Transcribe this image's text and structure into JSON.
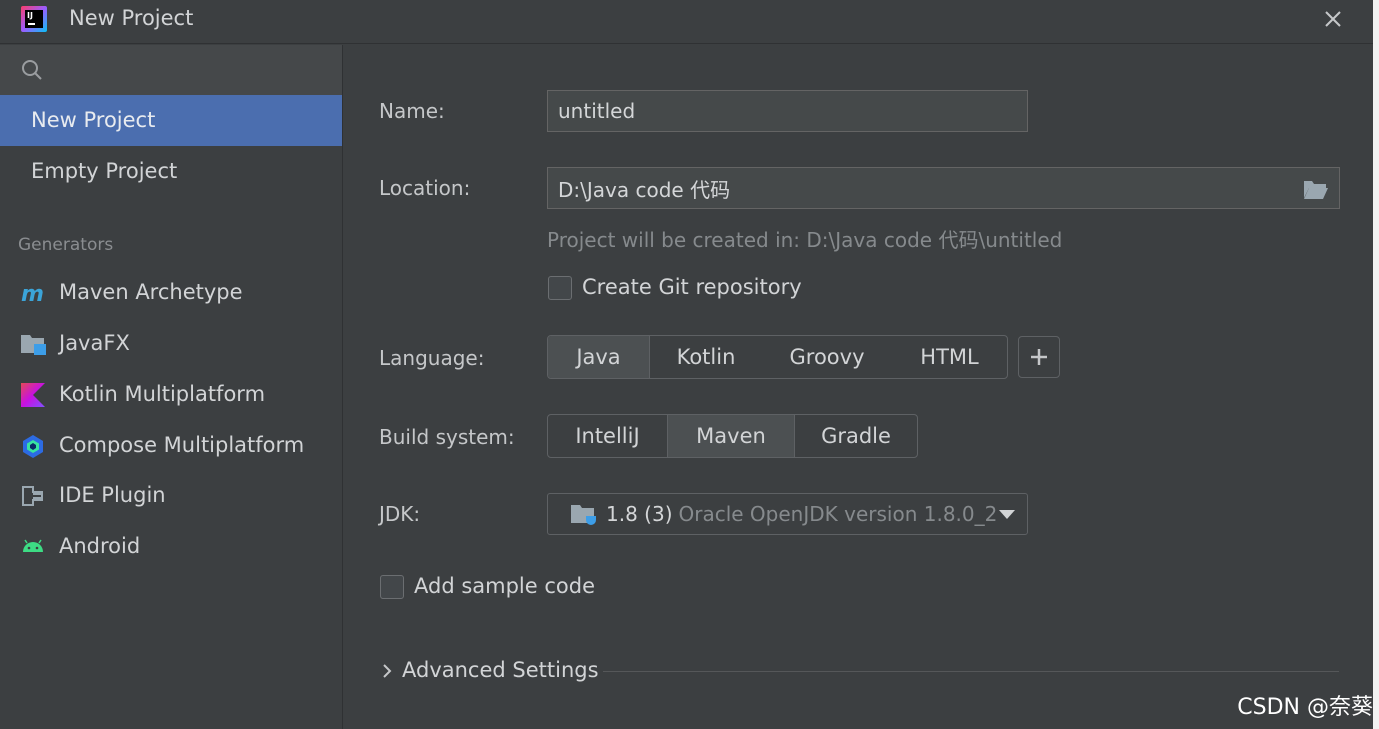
{
  "window": {
    "title": "New Project",
    "close_icon": "close-icon"
  },
  "sidebar": {
    "search_icon": "search-icon",
    "items": [
      {
        "label": "New Project",
        "selected": true
      },
      {
        "label": "Empty Project",
        "selected": false
      }
    ],
    "generators_header": "Generators",
    "generators": [
      {
        "label": "Maven Archetype",
        "icon": "maven-icon"
      },
      {
        "label": "JavaFX",
        "icon": "javafx-icon"
      },
      {
        "label": "Kotlin Multiplatform",
        "icon": "kotlin-icon"
      },
      {
        "label": "Compose Multiplatform",
        "icon": "compose-icon"
      },
      {
        "label": "IDE Plugin",
        "icon": "plugin-icon"
      },
      {
        "label": "Android",
        "icon": "android-icon"
      }
    ]
  },
  "form": {
    "name_label": "Name:",
    "name_value": "untitled",
    "location_label": "Location:",
    "location_value": "D:\\Java code 代码",
    "location_hint": "Project will be created in: D:\\Java code 代码\\untitled",
    "git_label": "Create Git repository",
    "git_checked": false,
    "language_label": "Language:",
    "languages": [
      "Java",
      "Kotlin",
      "Groovy",
      "HTML"
    ],
    "language_selected": "Java",
    "build_label": "Build system:",
    "build_systems": [
      "IntelliJ",
      "Maven",
      "Gradle"
    ],
    "build_selected": "Maven",
    "jdk_label": "JDK:",
    "jdk_version": "1.8 (3)",
    "jdk_desc": "Oracle OpenJDK version 1.8.0_2",
    "sample_label": "Add sample code",
    "sample_checked": false,
    "advanced_label": "Advanced Settings"
  },
  "watermark": "CSDN @奈葵",
  "colors": {
    "background": "#3c3f41",
    "selected": "#4b6eaf",
    "field": "#45494a",
    "text": "#d2d4d6",
    "hint": "#868a8d"
  }
}
